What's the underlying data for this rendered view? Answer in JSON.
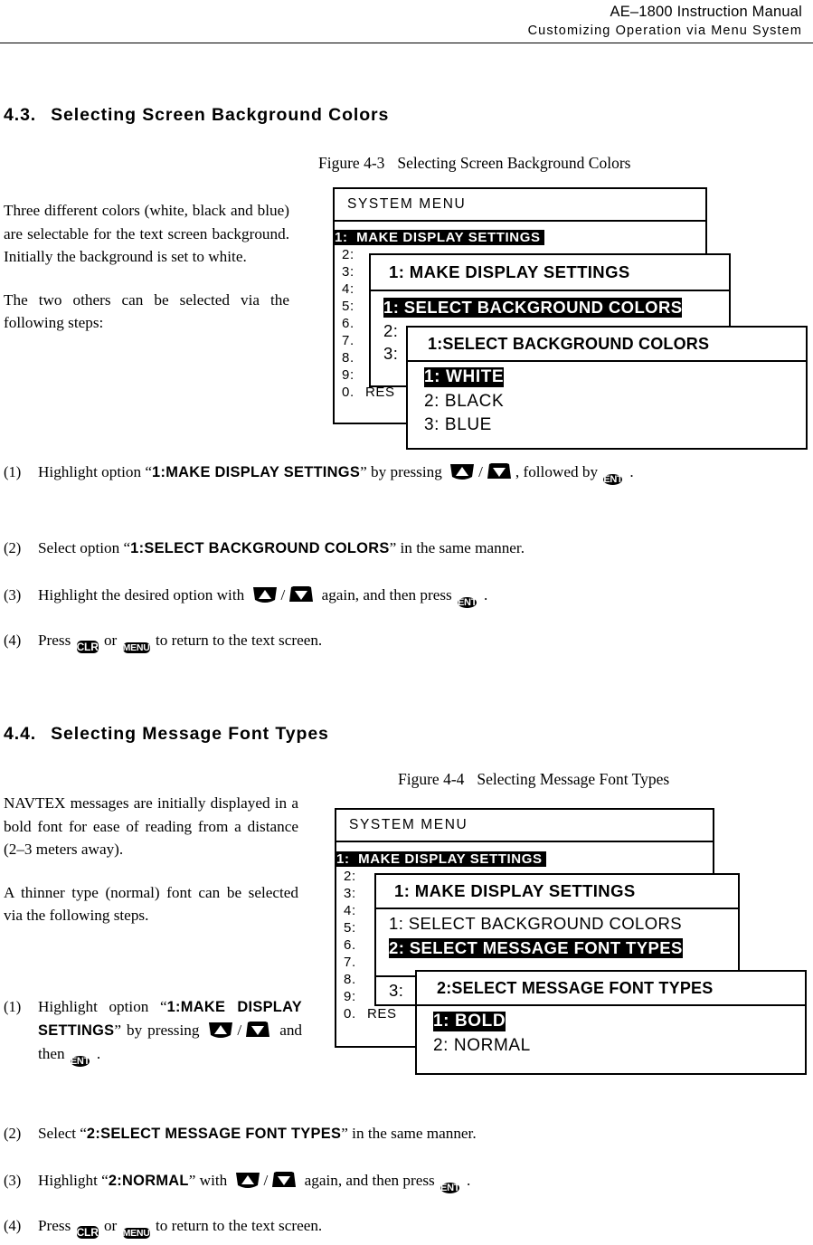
{
  "header": {
    "manual_title": "AE–1800 Instruction Manual",
    "chapter_subtitle": "Customizing  Operation  via  Menu  System"
  },
  "sections": [
    {
      "number": "4.3.",
      "title": "Selecting Screen Background Colors",
      "figure": {
        "caption_number": "Figure 4-3",
        "caption_title": "Selecting Screen Background Colors"
      },
      "paragraphs": [
        "Three different colors (white, black and blue) are selectable for the text screen background. Initially the background is set to white.",
        "The two others can be selected via the following steps:"
      ],
      "steps": [
        {
          "marker": "(1)",
          "pre": "Highlight option “",
          "option": "1:MAKE DISPLAY SETTINGS",
          "mid": "” by pressing",
          "post": ", followed by",
          "tail": "."
        },
        {
          "marker": "(2)",
          "pre": "Select option “",
          "option": "1:SELECT BACKGROUND COLORS",
          "mid": "” in the same manner.",
          "post": "",
          "tail": ""
        },
        {
          "marker": "(3)",
          "pre": "Highlight the desired option with",
          "option": "",
          "mid": "again, and then press",
          "post": "",
          "tail": "."
        },
        {
          "marker": "(4)",
          "pre": "Press",
          "option": "",
          "mid": "or",
          "post": "to return to the text screen.",
          "tail": ""
        }
      ]
    },
    {
      "number": "4.4.",
      "title": "Selecting Message Font Types",
      "figure": {
        "caption_number": "Figure 4-4",
        "caption_title": "Selecting Message Font Types"
      },
      "paragraphs": [
        "NAVTEX messages are initially displayed in a bold font for ease of reading from a distance (2–3 meters away).",
        "A thinner type (normal) font can be selected via the following steps."
      ],
      "steps": [
        {
          "marker": "(1)",
          "pre": "Highlight option “",
          "option": "1:MAKE DISPLAY SETTINGS",
          "mid": "” by pressing",
          "post": "and then",
          "tail": "."
        },
        {
          "marker": "(2)",
          "pre": "Select “",
          "option": "2:SELECT MESSAGE FONT TYPES",
          "mid": "” in the same manner.",
          "post": "",
          "tail": ""
        },
        {
          "marker": "(3)",
          "pre": "Highlight “",
          "option": "2:NORMAL",
          "mid": "” with",
          "post": "again, and then press",
          "tail": "."
        },
        {
          "marker": "(4)",
          "pre": "Press",
          "option": "",
          "mid": "or",
          "post": "to return to the text screen.",
          "tail": ""
        }
      ]
    }
  ],
  "keys": {
    "up_label": "up-arrow-key",
    "down_label": "down-arrow-key",
    "ent_label": "ENT",
    "clr_label": "CLR",
    "menu_label": "MENU",
    "slash": "/"
  },
  "diagram1": {
    "back_panel": {
      "title": "SYSTEM MENU",
      "rows": [
        {
          "index": "1:",
          "text": "MAKE DISPLAY SETTINGS",
          "highlighted": true
        },
        {
          "index": "2:",
          "text": "",
          "highlighted": false
        },
        {
          "index": "3:",
          "text": "",
          "highlighted": false
        },
        {
          "index": "4:",
          "text": "",
          "highlighted": false
        },
        {
          "index": "5:",
          "text": "",
          "highlighted": false
        },
        {
          "index": "6.",
          "text": "",
          "highlighted": false
        },
        {
          "index": "7.",
          "text": "",
          "highlighted": false
        },
        {
          "index": "8.",
          "text": "",
          "highlighted": false
        },
        {
          "index": "9:",
          "text": "",
          "highlighted": false
        },
        {
          "index": "0.",
          "text": "RES",
          "highlighted": false
        }
      ]
    },
    "mid_panel": {
      "title": "1: MAKE DISPLAY SETTINGS",
      "rows": [
        {
          "text": "1: SELECT BACKGROUND COLORS",
          "highlighted": true
        },
        {
          "text": "2:",
          "highlighted": false
        },
        {
          "text": "3:",
          "highlighted": false
        }
      ]
    },
    "front_panel": {
      "title": "1:SELECT BACKGROUND COLORS",
      "rows": [
        {
          "text": "1: WHITE",
          "highlighted": true
        },
        {
          "text": "2: BLACK",
          "highlighted": false
        },
        {
          "text": "3: BLUE",
          "highlighted": false
        }
      ]
    }
  },
  "diagram2": {
    "back_panel": {
      "title": "SYSTEM MENU",
      "rows": [
        {
          "index": "1:",
          "text": "MAKE DISPLAY SETTINGS",
          "highlighted": true
        },
        {
          "index": "2:",
          "text": "",
          "highlighted": false
        },
        {
          "index": "3:",
          "text": "",
          "highlighted": false
        },
        {
          "index": "4:",
          "text": "",
          "highlighted": false
        },
        {
          "index": "5:",
          "text": "",
          "highlighted": false
        },
        {
          "index": "6.",
          "text": "",
          "highlighted": false
        },
        {
          "index": "7.",
          "text": "",
          "highlighted": false
        },
        {
          "index": "8.",
          "text": "",
          "highlighted": false
        },
        {
          "index": "9:",
          "text": "",
          "highlighted": false
        },
        {
          "index": "0.",
          "text": "RES",
          "highlighted": false
        }
      ]
    },
    "mid_panel": {
      "title": "1: MAKE DISPLAY SETTINGS",
      "rows": [
        {
          "text": "1: SELECT BACKGROUND COLORS",
          "highlighted": false
        },
        {
          "text": "2: SELECT MESSAGE FONT TYPES",
          "highlighted": true
        },
        {
          "text": "3:",
          "highlighted": false
        }
      ]
    },
    "front_panel": {
      "title": "2:SELECT MESSAGE FONT TYPES",
      "rows": [
        {
          "text": "1: BOLD",
          "highlighted": true
        },
        {
          "text": "2: NORMAL",
          "highlighted": false
        }
      ]
    }
  },
  "colors": {
    "ink": "#000000",
    "paper": "#ffffff",
    "highlight_bg": "#000000",
    "highlight_fg": "#ffffff"
  }
}
